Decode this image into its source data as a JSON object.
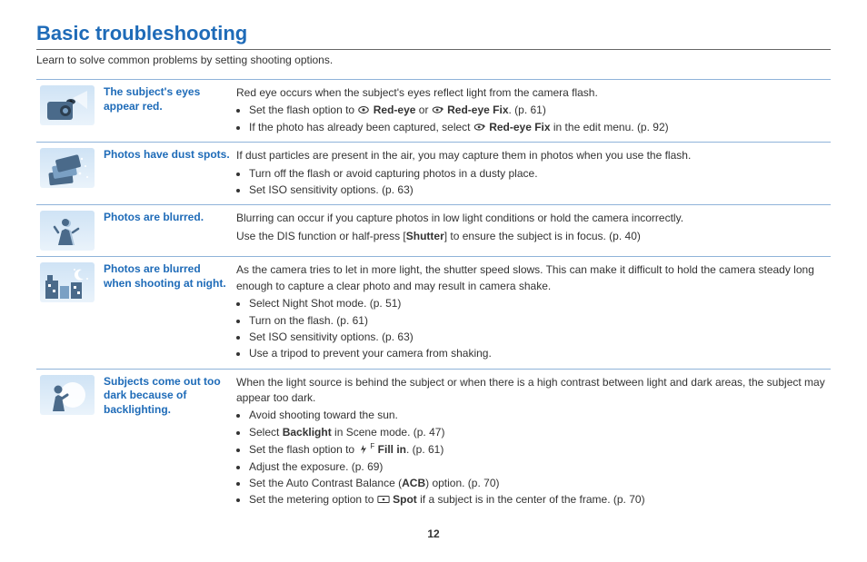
{
  "title": "Basic troubleshooting",
  "intro": "Learn to solve common problems by setting shooting options.",
  "pagenum": "12",
  "rows": [
    {
      "icon": "camera-flash-icon",
      "label": "The subject's eyes appear red.",
      "lead": "Red eye occurs when the subject's eyes reflect light from the camera flash.",
      "bullets_html": [
        "Set the flash option to <svg class='inline-icon' viewBox='0 0 16 12'><ellipse cx='8' cy='6' rx='6' ry='4' fill='none' stroke='#333' stroke-width='1.2'/><circle cx='8' cy='6' r='1.8' fill='#333'/></svg> <b>Red-eye</b> or <svg class='inline-icon' viewBox='0 0 16 12'><ellipse cx='7' cy='6' rx='5.5' ry='3.5' fill='none' stroke='#333' stroke-width='1.2'/><circle cx='7' cy='6' r='1.6' fill='#333'/><path d='M12 3 L14 5 L12 7' fill='none' stroke='#333' stroke-width='1.2'/></svg> <b>Red-eye Fix</b>. (p. 61)",
        "If the photo has already been captured, select <svg class='inline-icon' viewBox='0 0 16 12'><ellipse cx='7' cy='6' rx='5.5' ry='3.5' fill='none' stroke='#333' stroke-width='1.2'/><circle cx='7' cy='6' r='1.6' fill='#333'/><path d='M12 3 L14 5 L12 7' fill='none' stroke='#333' stroke-width='1.2'/></svg> <b>Red-eye Fix</b> in the edit menu. (p. 92)"
      ]
    },
    {
      "icon": "dust-photos-icon",
      "label": "Photos have dust spots.",
      "lead": "If dust particles are present in the air, you may capture them in photos when you use the flash.",
      "bullets_html": [
        "Turn off the flash or avoid capturing photos in a dusty place.",
        "Set ISO sensitivity options. (p. 63)"
      ]
    },
    {
      "icon": "blur-person-icon",
      "label": "Photos are blurred.",
      "lead": "Blurring can occur if you capture photos in low light conditions or hold the camera incorrectly.",
      "lead2": "Use the DIS function or half-press [<b>Shutter</b>] to ensure the subject is in focus. (p. 40)",
      "bullets_html": []
    },
    {
      "icon": "night-city-icon",
      "label": "Photos are blurred when shooting at night.",
      "lead": "As the camera tries to let in more light, the shutter speed slows. This can make it difficult to hold the camera steady long enough to capture a clear photo and may result in camera shake.",
      "bullets_html": [
        "Select Night Shot mode. (p. 51)",
        "Turn on the flash. (p. 61)",
        "Set ISO sensitivity options. (p. 63)",
        "Use a tripod to prevent your camera from shaking."
      ]
    },
    {
      "icon": "backlight-person-icon",
      "label": "Subjects come out too dark because of backlighting.",
      "lead": "When the light source is behind the subject or when there is a high contrast between light and dark areas, the subject may appear too dark.",
      "bullets_html": [
        "Avoid shooting toward the sun.",
        "Select <b>Backlight</b> in Scene mode. (p. 47)",
        "Set the flash option to <svg class='inline-icon' viewBox='0 0 12 12'><path d='M6 1 L3 7 L6 6 L5 11 L9 4 L6 5 Z' fill='#333'/></svg><sup style='font-size:8px'>F</sup> <b>Fill in</b>. (p. 61)",
        "Adjust the exposure. (p. 69)",
        "Set the Auto Contrast Balance (<b>ACB</b>) option. (p. 70)",
        "Set the metering option to <svg class='inline-icon' viewBox='0 0 16 12'><rect x='1' y='2' width='14' height='8' rx='1' fill='none' stroke='#333' stroke-width='1.1'/><circle cx='8' cy='6' r='1.5' fill='#333'/></svg> <b>Spot</b> if a subject is in the center of the frame. (p. 70)"
      ]
    }
  ]
}
